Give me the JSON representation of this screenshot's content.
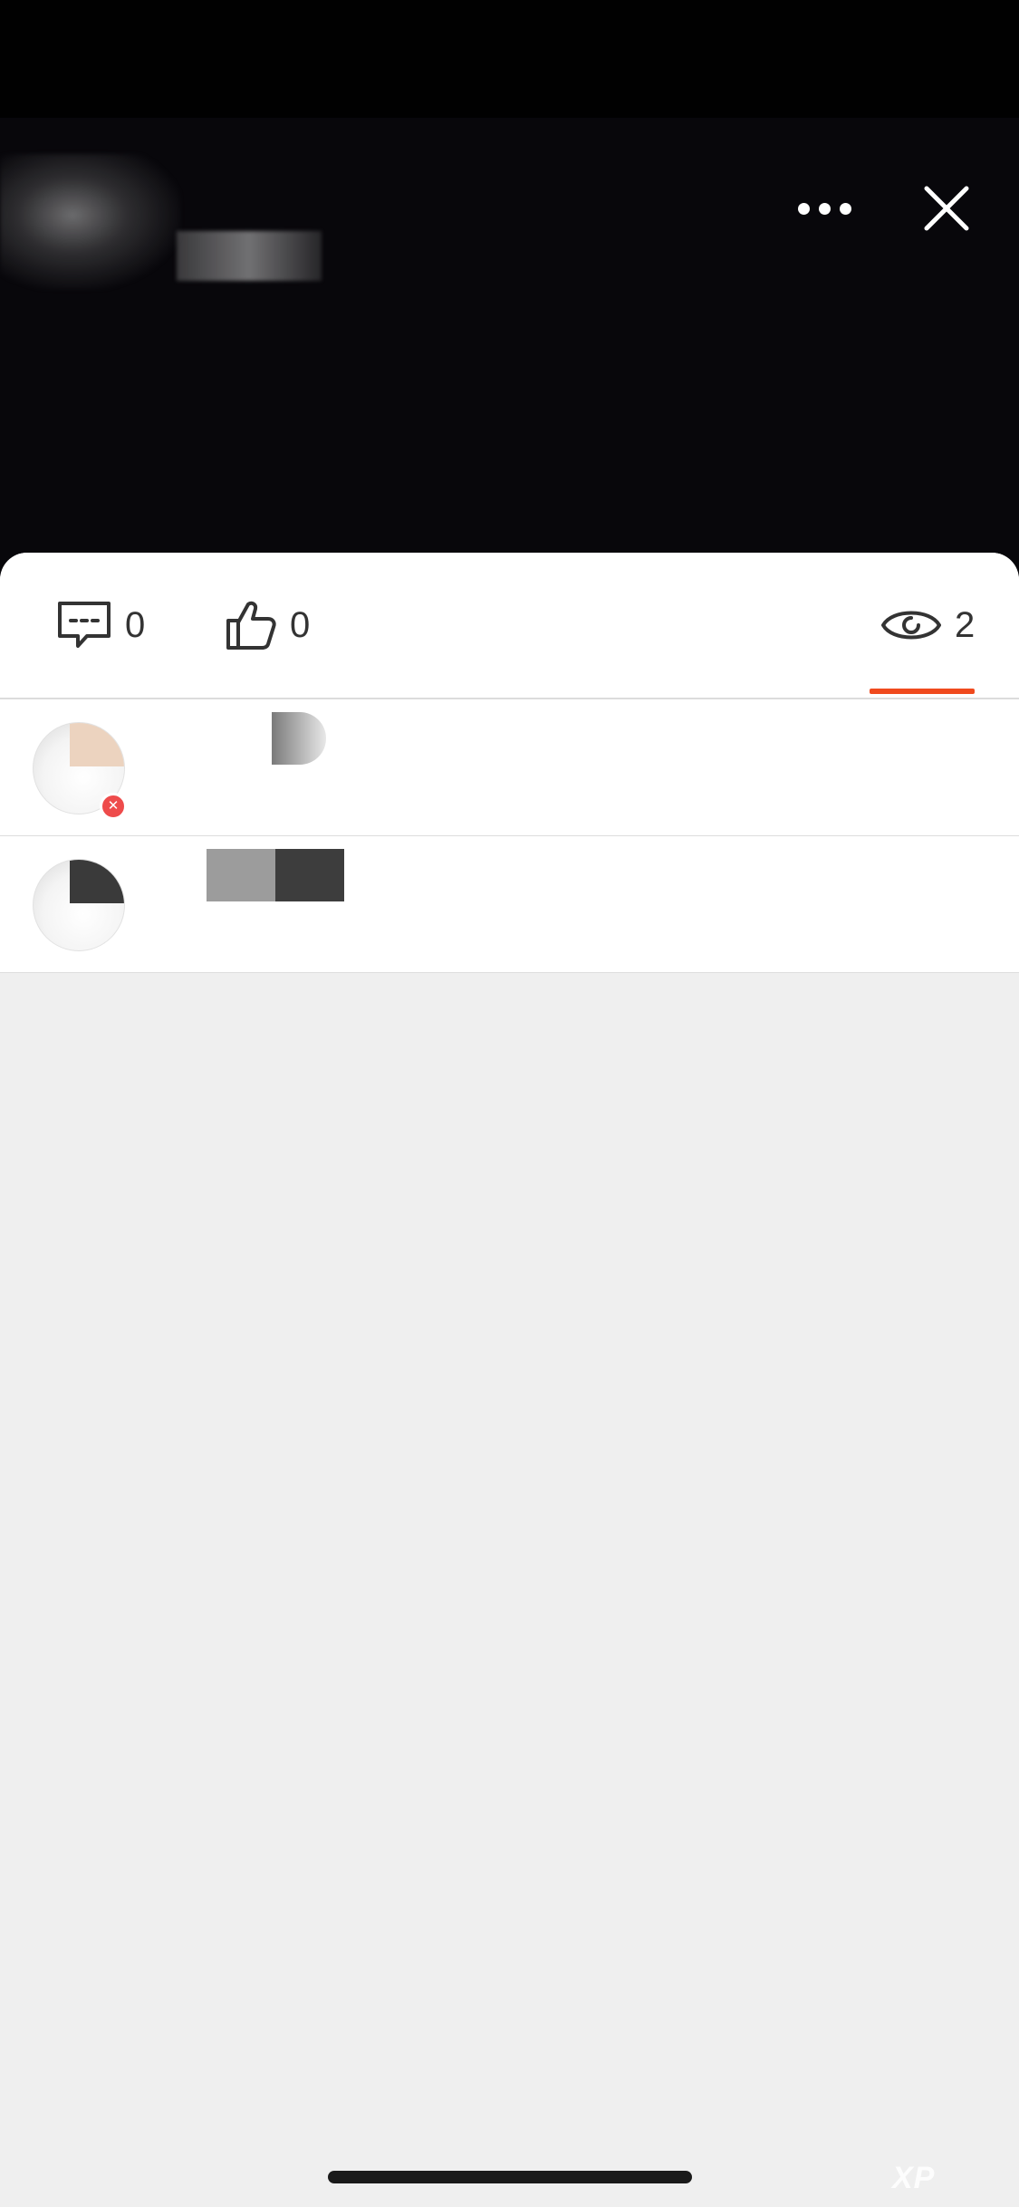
{
  "header": {
    "more_icon": "more-horizontal-icon",
    "close_icon": "close-icon"
  },
  "tabs": [
    {
      "id": "comments",
      "icon": "comment-icon",
      "count": "0"
    },
    {
      "id": "likes",
      "icon": "thumbs-up-icon",
      "count": "0"
    },
    {
      "id": "views",
      "icon": "eye-icon",
      "count": "2",
      "active": true
    }
  ],
  "viewers": [
    {
      "username": "",
      "has_badge": true
    },
    {
      "username": "",
      "has_badge": false
    }
  ],
  "colors": {
    "accent": "#f04a1e",
    "media_bg": "#08070b",
    "sheet_bg": "#efefef"
  }
}
